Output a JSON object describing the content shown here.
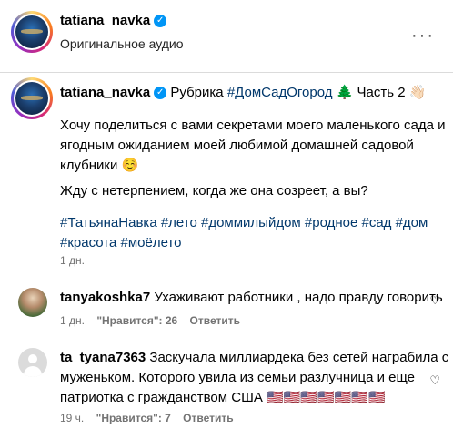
{
  "header": {
    "username": "tatiana_navka",
    "audio": "Оригинальное аудио",
    "more": "···"
  },
  "post": {
    "username": "tatiana_navka",
    "rubric": "Рубрика",
    "rubric_tag": "#ДомСадОгород",
    "rubric_emoji": "🌲",
    "part": "Часть 2",
    "part_emoji": "👋🏻",
    "paragraph1_line1": "Хочу поделиться с вами секретами моего маленького сада и",
    "paragraph1_line2": "ягодным ожиданием моей любимой домашней садовой",
    "paragraph1_line3": "клубники ☺️",
    "paragraph2": "Жду с нетерпением, когда же она созреет, а вы?",
    "tags_line1": "#ТатьянаНавка #лето #доммилыйдом #родное #сад #дом",
    "tags_line2": "#красота #моёлето",
    "time": "1 дн."
  },
  "comments": [
    {
      "username": "tanyakoshka7",
      "text": "Ухаживают работники , надо правду говорить",
      "time": "1 дн.",
      "likes": "\"Нравится\": 26",
      "reply": "Ответить"
    },
    {
      "username": "ta_tyana7363",
      "text_line1": "Заскучала миллиардека без сетей награбила с",
      "text_line2": "муженьком. Которого увила из семьи разлучница и еще",
      "text_line3": "патриотка с гражданством США 🇺🇸🇺🇸🇺🇸🇺🇸🇺🇸🇺🇸🇺🇸",
      "time": "19 ч.",
      "likes": "\"Нравится\": 7",
      "reply": "Ответить"
    }
  ],
  "colors": {
    "link": "#00376b",
    "muted": "#737373",
    "verified": "#0095f6",
    "divider": "#dbdbdb"
  }
}
